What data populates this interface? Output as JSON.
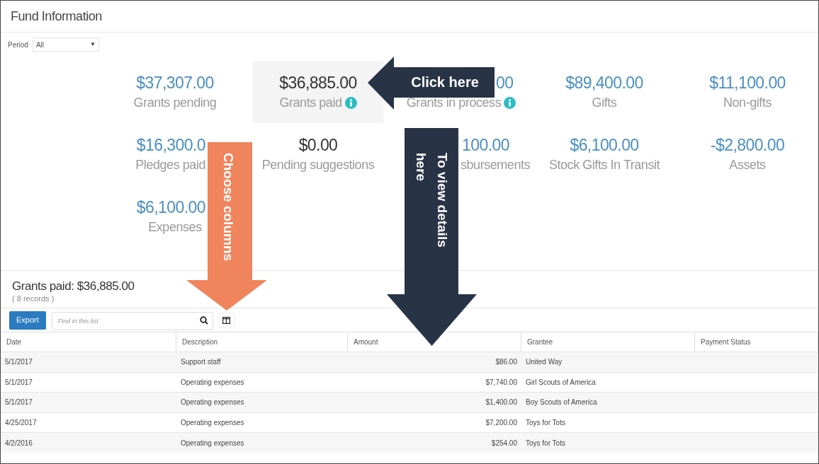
{
  "title": "Fund Information",
  "period": {
    "label": "Period",
    "value": "All",
    "caret": "▼"
  },
  "tiles": [
    {
      "amount": "$37,307.00",
      "label": "Grants pending",
      "selected": false,
      "linked": true,
      "info": false
    },
    {
      "amount": "$36,885.00",
      "label": "Grants paid",
      "selected": true,
      "linked": true,
      "info": true
    },
    {
      "amount": "00",
      "label": "Grants in process",
      "selected": false,
      "linked": true,
      "info": true
    },
    {
      "amount": "$89,400.00",
      "label": "Gifts",
      "selected": false,
      "linked": true,
      "info": false
    },
    {
      "amount": "$11,100.00",
      "label": "Non-gifts",
      "selected": false,
      "linked": true,
      "info": false
    },
    {
      "amount": "$16,300.0",
      "label": "Pledges paid",
      "selected": false,
      "linked": true,
      "info": false
    },
    {
      "amount": "$0.00",
      "label": "Pending suggestions",
      "selected": false,
      "linked": false,
      "info": false
    },
    {
      "amount": "100.00",
      "label": "sbursements",
      "selected": false,
      "linked": true,
      "info": false
    },
    {
      "amount": "$6,100.00",
      "label": "Stock Gifts In Transit",
      "selected": false,
      "linked": true,
      "info": false
    },
    {
      "amount": "-$2,800.00",
      "label": "Assets",
      "selected": false,
      "linked": true,
      "info": false
    },
    {
      "amount": "$6,100.00",
      "label": "Expenses",
      "selected": false,
      "linked": true,
      "info": false
    }
  ],
  "list": {
    "heading": "Grants paid: $36,885.00",
    "count": "( 8 records )",
    "export": "Export",
    "search": {
      "placeholder": "Find in this list"
    }
  },
  "table": {
    "columns": [
      "Date",
      "Description",
      "Amount",
      "Grantee",
      "Payment Status"
    ],
    "rows": [
      [
        "5/1/2017",
        "Support staff",
        "$86.00",
        "United Way"
      ],
      [
        "5/1/2017",
        "Operating expenses",
        "$7,740.00",
        "Girl Scouts of America"
      ],
      [
        "5/1/2017",
        "Operating expenses",
        "$1,400.00",
        "Boy Scouts of America"
      ],
      [
        "4/25/2017",
        "Operating expenses",
        "$7,200.00",
        "Toys for Tots"
      ],
      [
        "4/2/2016",
        "Operating expenses",
        "$254.00",
        "Toys for Tots"
      ]
    ]
  },
  "annotations": [
    {
      "kind": "left-arrow",
      "text": "Click here",
      "color": "#283346"
    },
    {
      "kind": "down-arrow",
      "text": "Choose columns",
      "color": "#f0845c"
    },
    {
      "kind": "down-arrow",
      "text": "To view details here",
      "color": "#283346"
    }
  ]
}
